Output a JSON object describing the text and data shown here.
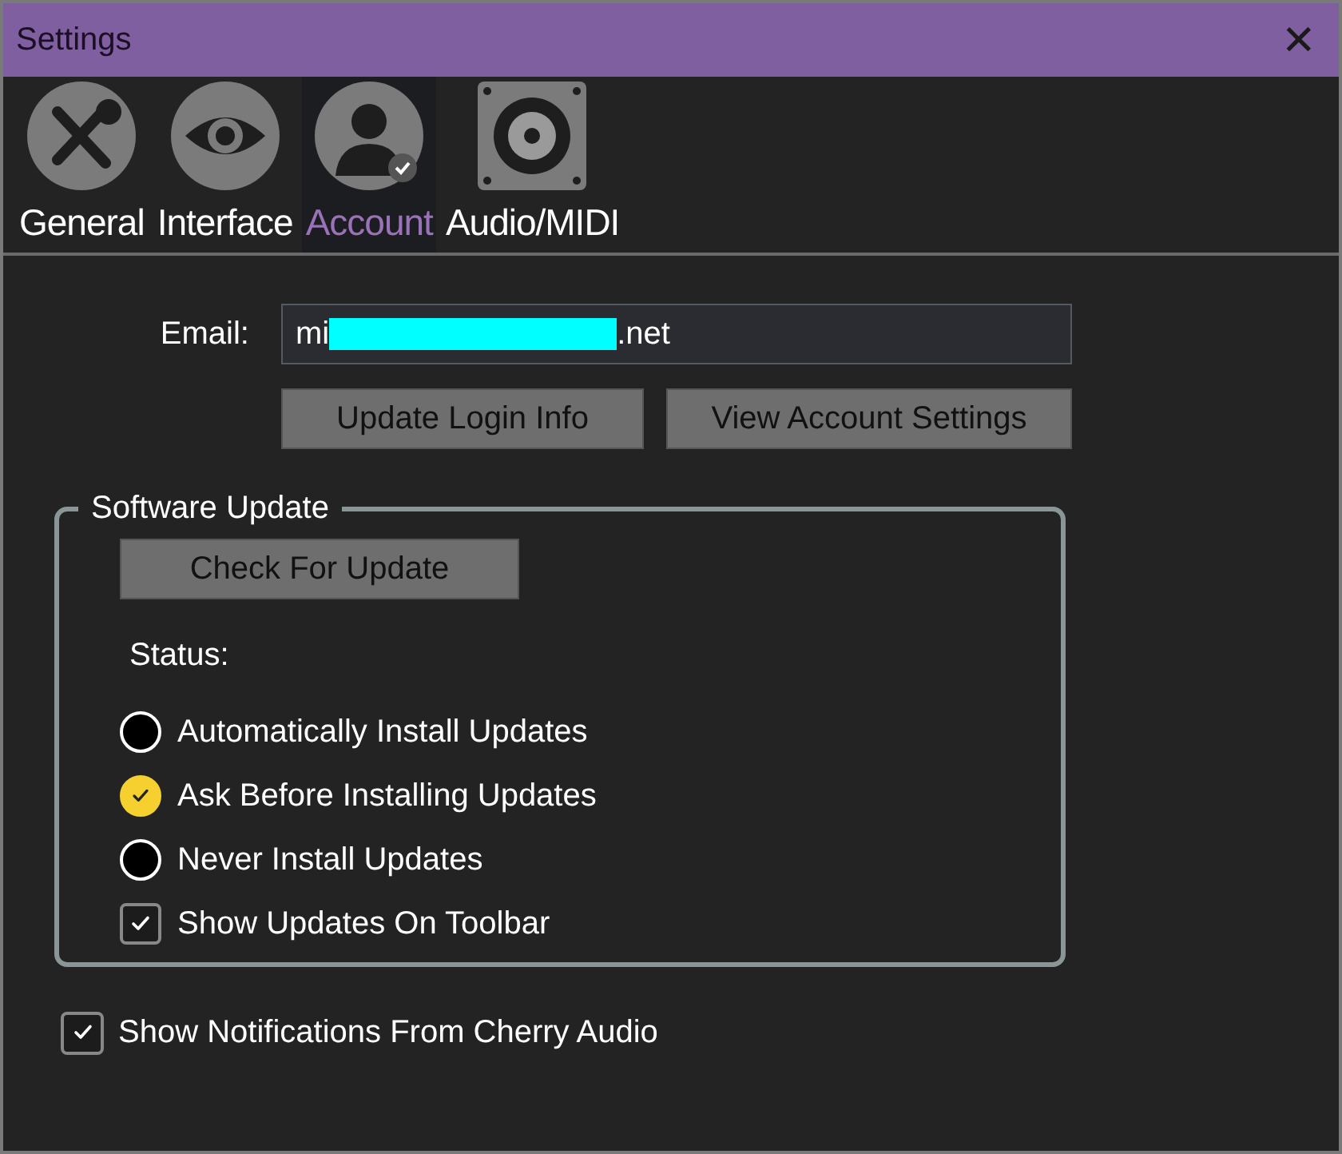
{
  "window": {
    "title": "Settings",
    "close": "✕"
  },
  "tabs": [
    {
      "label": "General",
      "kind": "tools",
      "selected": false
    },
    {
      "label": "Interface",
      "kind": "eye",
      "selected": false
    },
    {
      "label": "Account",
      "kind": "person",
      "selected": true
    },
    {
      "label": "Audio/MIDI",
      "kind": "speaker",
      "selected": false
    }
  ],
  "email": {
    "label": "Email:",
    "value_start": "mi",
    "value_end": ".net",
    "redacted": true
  },
  "account_buttons": [
    "Update Login Info",
    "View Account Settings"
  ],
  "software_update": {
    "title": "Software Update",
    "button": "Check For Update",
    "status_label": "Status:",
    "options": [
      {
        "label": "Automatically Install Updates",
        "kind": "radio",
        "selected": false
      },
      {
        "label": "Ask Before Installing Updates",
        "kind": "radio",
        "selected": true
      },
      {
        "label": "Never Install Updates",
        "kind": "radio",
        "selected": false
      },
      {
        "label": "Show Updates On Toolbar",
        "kind": "checkbox",
        "checked": true
      }
    ]
  },
  "notifications": {
    "label": "Show Notifications From Cherry Audio",
    "checked": true
  }
}
